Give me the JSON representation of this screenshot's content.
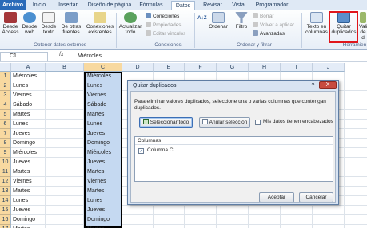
{
  "ribbon_tabs": [
    "Archivo",
    "Inicio",
    "Insertar",
    "Diseño de página",
    "Fórmulas",
    "Datos",
    "Revisar",
    "Vista",
    "Programador"
  ],
  "active_tab": "Datos",
  "ribbon": {
    "access": "Desde Access",
    "web": "Desde web",
    "text": "Desde texto",
    "other": "De otras fuentes",
    "existing": "Conexiones existentes",
    "external_group": "Obtener datos externos",
    "refresh": "Actualizar todo",
    "connections": "Conexiones",
    "properties": "Propiedades",
    "edit_links": "Editar vínculos",
    "connections_group": "Conexiones",
    "sort_az": "A↓Z",
    "sort": "Ordenar",
    "filter": "Filtro",
    "clear": "Borrar",
    "reapply": "Volver a aplicar",
    "advanced": "Avanzadas",
    "sort_filter_group": "Ordenar y filtrar",
    "text_to_columns": "Texto en columnas",
    "remove_duplicates": "Quitar duplicados",
    "validation": "Vali de d",
    "tools_group": "Herramien"
  },
  "formula_bar": {
    "name_box": "C1",
    "fx": "fx",
    "value": "Miércoles"
  },
  "columns": [
    "A",
    "B",
    "C",
    "D",
    "E",
    "F",
    "G",
    "H",
    "I",
    "J"
  ],
  "rows": [
    "1",
    "2",
    "3",
    "4",
    "5",
    "6",
    "7",
    "8",
    "9",
    "10",
    "11",
    "12",
    "13",
    "14",
    "15",
    "16",
    "17"
  ],
  "col_a": [
    "Miércoles",
    "Lunes",
    "Viernes",
    "Sábado",
    "Martes",
    "Lunes",
    "Jueves",
    "Domingo",
    "Miércoles",
    "Jueves",
    "Martes",
    "Viernes",
    "Martes",
    "Lunes",
    "Jueves",
    "Domingo",
    "Martes"
  ],
  "col_c": [
    "Miércoles",
    "Lunes",
    "Viernes",
    "Sábado",
    "Martes",
    "Lunes",
    "Jueves",
    "Domingo",
    "Miércoles",
    "Jueves",
    "Martes",
    "Viernes",
    "Martes",
    "Lunes",
    "Jueves",
    "Domingo",
    "Martes"
  ],
  "dialog": {
    "title": "Quitar duplicados",
    "help": "?",
    "close": "X",
    "message": "Para eliminar valores duplicados, seleccione una o varias columnas que contengan duplicados.",
    "select_all": "Seleccionar todo",
    "unselect_all": "Anular selección",
    "has_headers": "Mis datos tienen encabezados",
    "has_headers_checked": false,
    "columns_header": "Columnas",
    "column_items": [
      "Columna C"
    ],
    "column_checked": true,
    "accept": "Aceptar",
    "cancel": "Cancelar"
  },
  "colors": {
    "accent": "#2a6ab8",
    "selection": "#c5d9f1",
    "highlight_box": "#e0161b"
  }
}
